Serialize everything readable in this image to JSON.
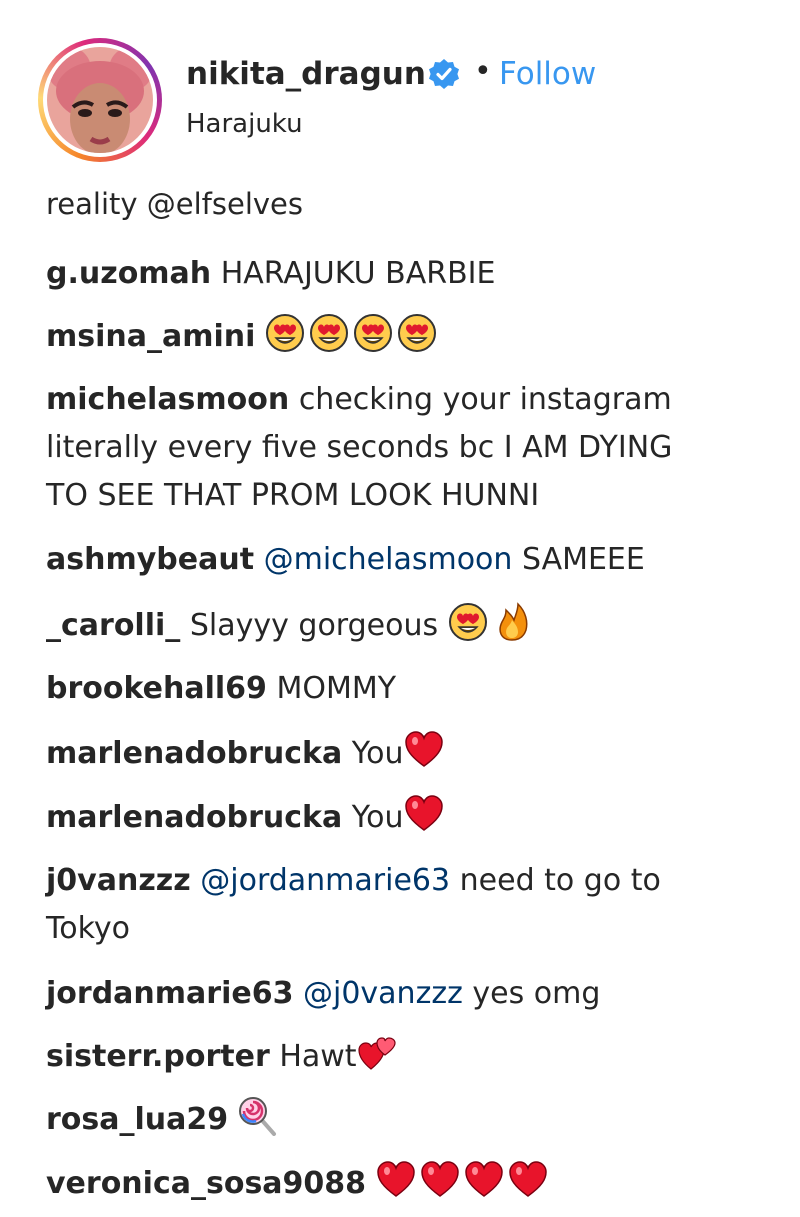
{
  "post_header": {
    "username": "nikita_dragun",
    "separator": "•",
    "follow_label": "Follow",
    "location": "Harajuku",
    "colors": {
      "follow": "#3897f0",
      "verified": "#3897f0",
      "text": "#262626"
    }
  },
  "comments": {
    "cut_off_line": "reality @elfselves",
    "items": [
      {
        "user": "g.uzomah",
        "text": "HARAJUKU BARBIE"
      },
      {
        "user": "msina_amini",
        "emojis": "heart-eyes-emoji x4"
      },
      {
        "user": "michelasmoon",
        "text": "checking your instagram",
        "text2": "literally every five seconds bc I AM DYING",
        "text3": "TO SEE THAT PROM LOOK HUNNI"
      },
      {
        "user": "ashmybeaut",
        "mention": "@michelasmoon",
        "text": "SAMEEE"
      },
      {
        "user": "_carolli_",
        "text": "Slayyy gorgeous",
        "emojis": "heart-eyes-emoji, fire-emoji"
      },
      {
        "user": "brookehall69",
        "text": "MOMMY"
      },
      {
        "user": "marlenadobrucka",
        "text": "You",
        "emojis": "red-heart-emoji"
      },
      {
        "user": "marlenadobrucka",
        "text": "You",
        "emojis": "red-heart-emoji"
      },
      {
        "user": "j0vanzzz",
        "mention": "@jordanmarie63",
        "text": "need to go to",
        "text2": "Tokyo"
      },
      {
        "user": "jordanmarie63",
        "mention": "@j0vanzzz",
        "text": "yes omg"
      },
      {
        "user": "sisterr.porter",
        "text": "Hawt",
        "emojis": "two-hearts-emoji"
      },
      {
        "user": "rosa_lua29",
        "emojis": "lollipop-emoji"
      },
      {
        "user": "veronica_sosa9088",
        "emojis": "red-heart-emoji x4"
      }
    ]
  }
}
